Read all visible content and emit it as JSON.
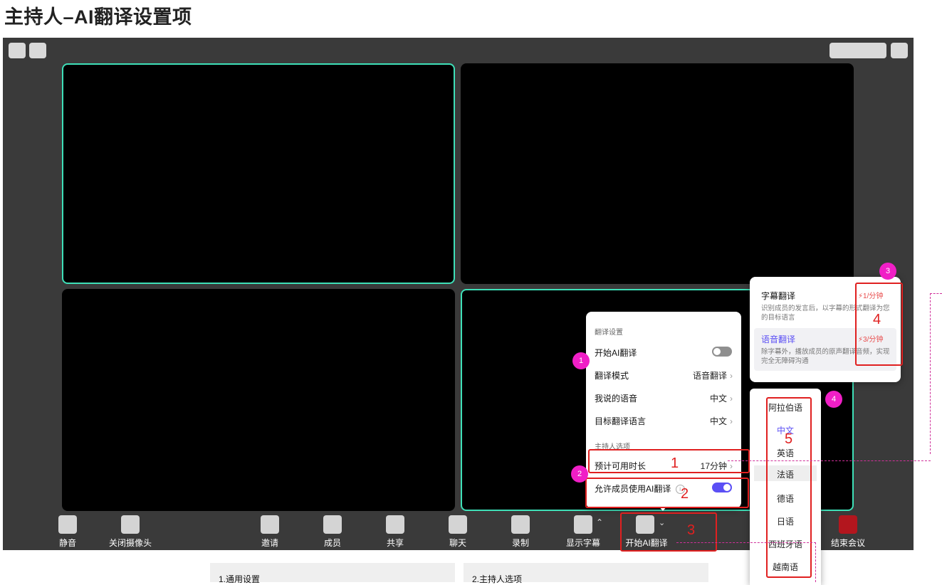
{
  "page_title": "主持人–AI翻译设置项",
  "toolbar": {
    "mute": "静音",
    "camera_off": "关闭摄像头",
    "invite": "邀请",
    "members": "成员",
    "share": "共享",
    "chat": "聊天",
    "record": "录制",
    "subtitles": "显示字幕",
    "start_ai_translate": "开始AI翻译",
    "end_meeting": "结束会议"
  },
  "settings_panel": {
    "section_title": "翻译设置",
    "start_ai_label": "开始AI翻译",
    "start_ai_on": false,
    "mode_label": "翻译模式",
    "mode_value": "语音翻译",
    "my_lang_label": "我说的语音",
    "my_lang_value": "中文",
    "target_lang_label": "目标翻译语言",
    "target_lang_value": "中文",
    "host_section_title": "主持人选项",
    "est_time_label": "预计可用时长",
    "est_time_value": "17分钟",
    "allow_members_label": "允许成员使用AI翻译",
    "allow_members_on": true
  },
  "mode_popup": {
    "subtitle_title": "字幕翻译",
    "subtitle_desc": "识别成员的发言后，以字幕的形式翻译为您的目标语言",
    "subtitle_rate": "1/分钟",
    "voice_title": "语音翻译",
    "voice_desc": "除字幕外，播放成员的原声翻译音频，实现完全无障碍沟通",
    "voice_rate": "3/分钟"
  },
  "languages": [
    "阿拉伯语",
    "中文",
    "英语",
    "法语",
    "德语",
    "日语",
    "西班牙语",
    "越南语"
  ],
  "selected_language": "中文",
  "annotations": {
    "marker_1": "1",
    "marker_2": "2",
    "marker_3": "3",
    "marker_4": "4",
    "red_1": "1",
    "red_2": "2",
    "red_3": "3",
    "red_4": "4",
    "red_5": "5"
  },
  "footer": {
    "col1_title": "1.通用设置",
    "col2_title": "2.主持人选项"
  },
  "colors": {
    "accent_purple": "#5b4ff5",
    "tile_border": "#3ee0b8",
    "annotation_red": "#e02020",
    "marker_pink": "#f01fc6",
    "end_button": "#b3161e"
  }
}
